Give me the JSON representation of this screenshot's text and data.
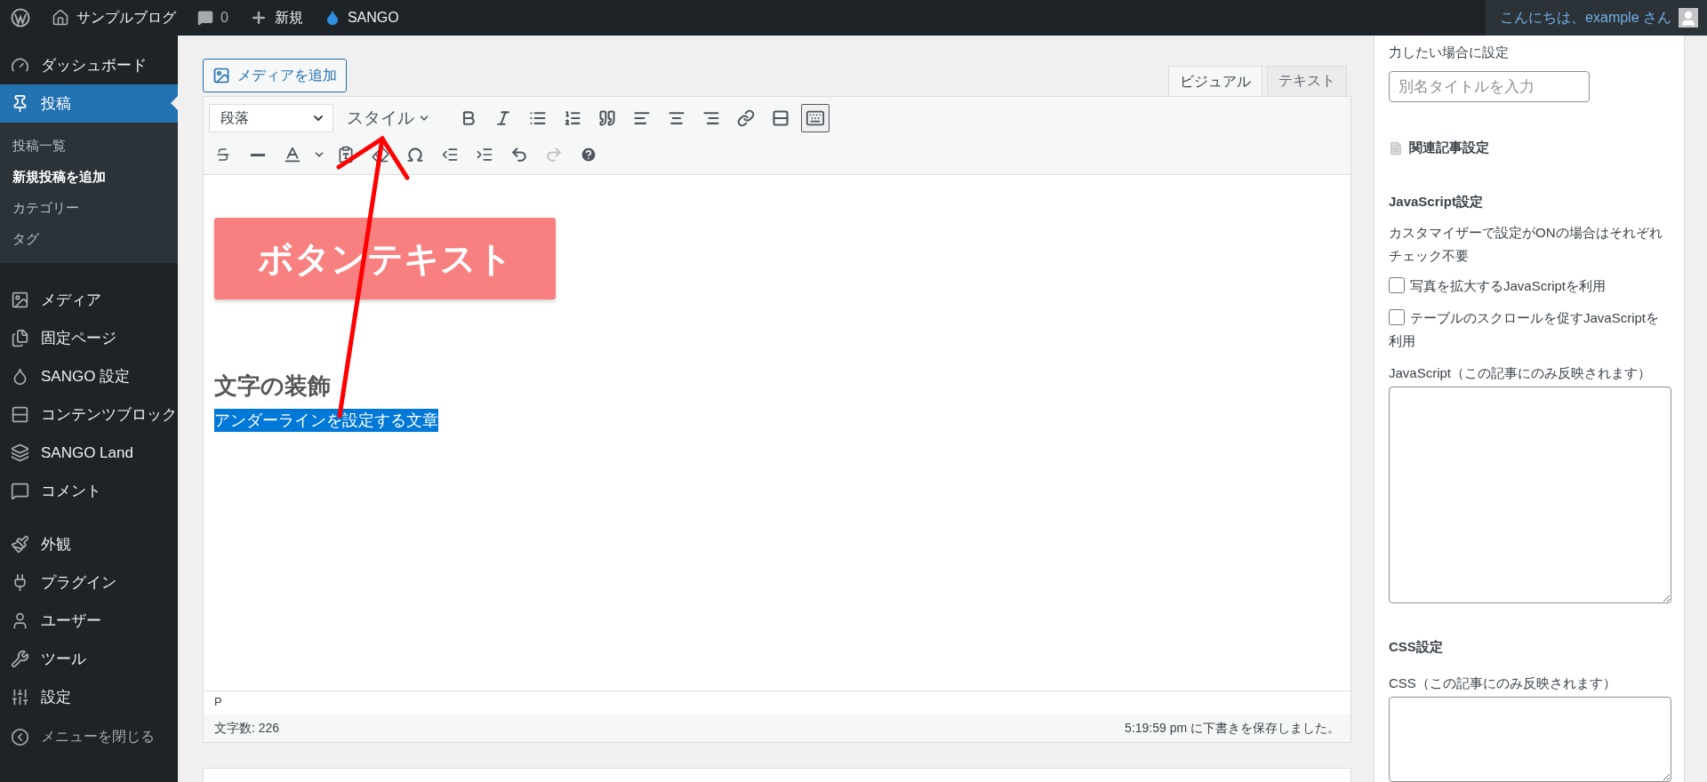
{
  "admin_bar": {
    "site_name": "サンプルブログ",
    "comments": "0",
    "new_label": "新規",
    "theme_label": "SANGO",
    "greeting": "こんにちは、example さん"
  },
  "sidebar": {
    "groups": [
      {
        "items": [
          {
            "label": "ダッシュボード",
            "selected": false
          },
          {
            "label": "投稿",
            "selected": true,
            "children": [
              {
                "label": "投稿一覧",
                "selected": false
              },
              {
                "label": "新規投稿を追加",
                "selected": true
              },
              {
                "label": "カテゴリー",
                "selected": false
              },
              {
                "label": "タグ",
                "selected": false
              }
            ]
          }
        ]
      },
      {
        "items": [
          {
            "label": "メディア",
            "selected": false
          },
          {
            "label": "固定ページ",
            "selected": false
          },
          {
            "label": "SANGO 設定",
            "selected": false
          },
          {
            "label": "コンテンツブロック",
            "selected": false
          },
          {
            "label": "SANGO Land",
            "selected": false
          },
          {
            "label": "コメント",
            "selected": false
          }
        ]
      },
      {
        "items": [
          {
            "label": "外観",
            "selected": false
          },
          {
            "label": "プラグイン",
            "selected": false
          },
          {
            "label": "ユーザー",
            "selected": false
          },
          {
            "label": "ツール",
            "selected": false
          },
          {
            "label": "設定",
            "selected": false
          }
        ]
      }
    ],
    "collapse_label": "メニューを閉じる"
  },
  "editor": {
    "media_button": "メディアを追加",
    "tabs": [
      {
        "label": "ビジュアル",
        "selected": true
      },
      {
        "label": "テキスト",
        "selected": false
      }
    ],
    "toolbar": {
      "format": "段落",
      "styles": "スタイル",
      "toggle_pressed": true,
      "redo_disabled": true
    },
    "content": {
      "button_text": "ボタンテキスト",
      "heading": "文字の装飾",
      "paragraph": "アンダーラインを設定する文章",
      "paragraph_selected": true
    },
    "path": "P",
    "word_count": "文字数: 226",
    "save_status": "5:19:59 pm に下書きを保存しました。"
  },
  "side_panel": {
    "alias_note": "力したい場合に設定",
    "alias_placeholder": "別名タイトルを入力",
    "related_heading": "関連記事設定",
    "js_heading": "JavaScript設定",
    "js_note": "カスタマイザーで設定がONの場合はそれぞれチェック不要",
    "checkboxes": [
      {
        "label": "写真を拡大するJavaScriptを利用",
        "checked": false
      },
      {
        "label": "テーブルのスクロールを促すJavaScriptを利用",
        "checked": false
      }
    ],
    "js_label": "JavaScript（この記事にのみ反映されます）",
    "css_heading": "CSS設定",
    "css_label": "CSS（この記事にのみ反映されます）"
  }
}
